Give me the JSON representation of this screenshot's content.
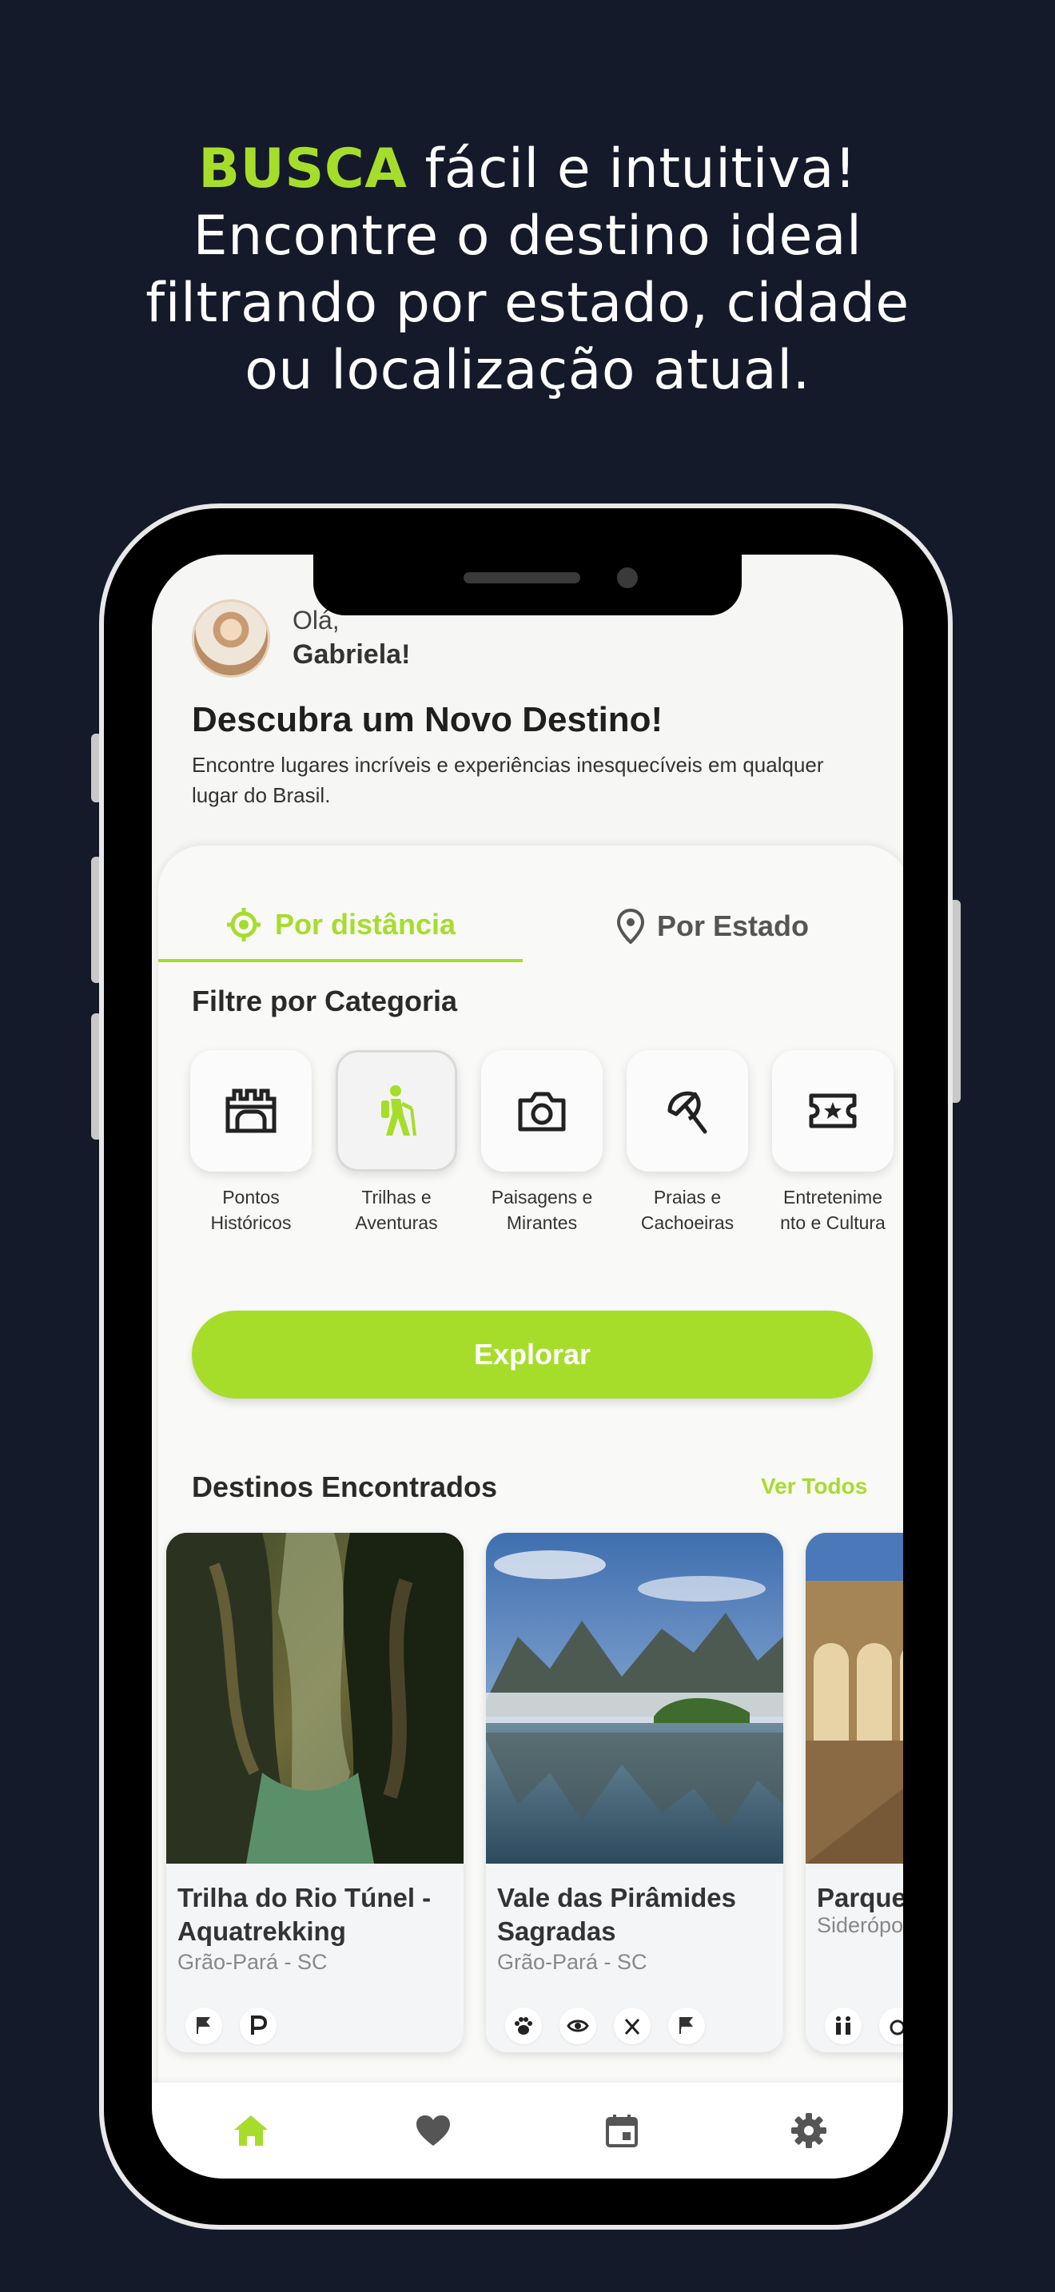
{
  "headline": {
    "accent": "BUSCA",
    "line1_rest": " fácil e intuitiva!",
    "line2": "Encontre o destino ideal",
    "line3": "filtrando por estado, cidade",
    "line4": "ou localização atual."
  },
  "greeting": {
    "hello": "Olá,",
    "name": "Gabriela!"
  },
  "hero": {
    "title": "Descubra um Novo Destino!",
    "subtitle": "Encontre lugares incríveis e experiências inesquecíveis em qualquer lugar do Brasil."
  },
  "tabs": [
    {
      "label": "Por distância",
      "icon": "target-location-icon",
      "active": true
    },
    {
      "label": "Por Estado",
      "icon": "map-pin-icon",
      "active": false
    }
  ],
  "filter": {
    "title": "Filtre por Categoria",
    "categories": [
      {
        "line1": "Pontos",
        "line2": "Históricos",
        "icon": "castle-icon"
      },
      {
        "line1": "Trilhas e",
        "line2": "Aventuras",
        "icon": "hiker-icon",
        "active": true
      },
      {
        "line1": "Paisagens e",
        "line2": "Mirantes",
        "icon": "camera-icon"
      },
      {
        "line1": "Praias e",
        "line2": "Cachoeiras",
        "icon": "umbrella-icon"
      },
      {
        "line1": "Entretenime",
        "line2": "nto e Cultura",
        "icon": "ticket-icon"
      }
    ]
  },
  "explore_label": "Explorar",
  "destinations": {
    "title": "Destinos Encontrados",
    "see_all": "Ver Todos",
    "cards": [
      {
        "name": "Trilha do Rio Túnel - Aquatrekking",
        "location": "Grão-Pará - SC",
        "amenities": [
          "flag-icon",
          "parking-icon"
        ]
      },
      {
        "name": "Vale das Pirâmides Sagradas",
        "location": "Grão-Pará - SC",
        "amenities": [
          "paw-icon",
          "eye-icon",
          "utensils-icon",
          "flag-icon"
        ]
      },
      {
        "name": "Parque",
        "location": "Siderópo",
        "amenities": [
          "restroom-icon",
          "accessibility-icon"
        ]
      }
    ]
  },
  "nav": [
    "home-icon",
    "heart-icon",
    "calendar-icon",
    "gear-icon"
  ],
  "colors": {
    "accent": "#a6dd2b",
    "background": "#141a2a",
    "screen": "#f6f6f4"
  }
}
